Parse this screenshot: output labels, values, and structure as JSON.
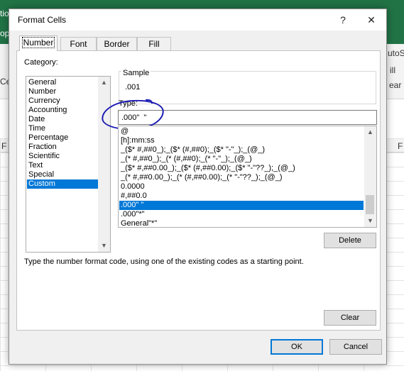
{
  "background": {
    "fragments_top_left": [
      "tio",
      "ope",
      "Cer",
      "F"
    ],
    "fragments_right": [
      "utoS",
      "ill",
      "ear",
      "F"
    ]
  },
  "dialog": {
    "title": "Format Cells",
    "help_glyph": "?",
    "close_glyph": "✕",
    "tabs": [
      {
        "label": "Number",
        "active": true
      },
      {
        "label": "Font",
        "active": false
      },
      {
        "label": "Border",
        "active": false
      },
      {
        "label": "Fill",
        "active": false
      }
    ],
    "category": {
      "label": "Category:",
      "items": [
        "General",
        "Number",
        "Currency",
        "Accounting",
        "Date",
        "Time",
        "Percentage",
        "Fraction",
        "Scientific",
        "Text",
        "Special",
        "Custom"
      ],
      "selected": "Custom"
    },
    "sample": {
      "label": "Sample",
      "value": ".001"
    },
    "type": {
      "label": "Type:",
      "value": ".000\"  \""
    },
    "formats": {
      "items": [
        "@",
        "[h]:mm:ss",
        "_($* #,##0_);_($* (#,##0);_($* \"-\"_);_(@_)",
        "_(* #,##0_);_(* (#,##0);_(* \"-\"_);_(@_)",
        "_($* #,##0.00_);_($* (#,##0.00);_($* \"-\"??_);_(@_)",
        "_(* #,##0.00_);_(* (#,##0.00);_(* \"-\"??_);_(@_)",
        "0.0000",
        "#,##0.0",
        ".000\"  \"",
        ".000\"*\"",
        "General\"*\""
      ],
      "selected": ".000\"  \""
    },
    "delete_label": "Delete",
    "description": "Type the number format code, using one of the existing codes as a starting point.",
    "clear_label": "Clear",
    "ok_label": "OK",
    "cancel_label": "Cancel",
    "scroll_up_glyph": "▲",
    "scroll_down_glyph": "▼",
    "colors": {
      "accent": "#0078d7",
      "annotation": "#1c1cb4",
      "excel_green": "#217346"
    }
  }
}
